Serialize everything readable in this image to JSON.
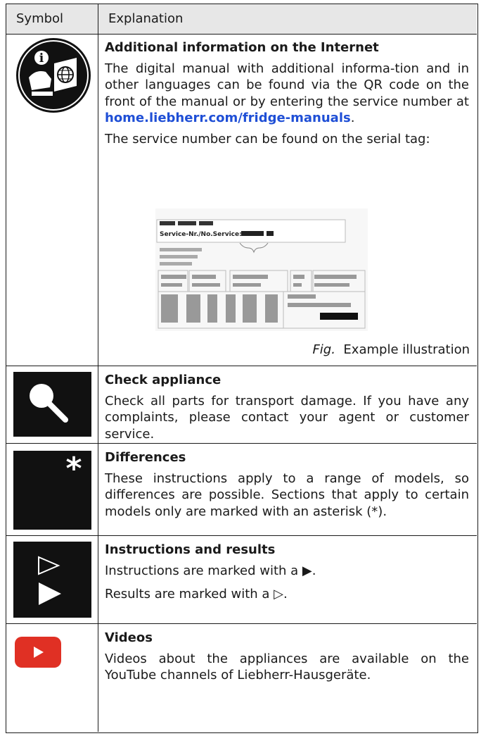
{
  "header": {
    "col1": "Symbol",
    "col2": "Explanation"
  },
  "rows": [
    {
      "title": "Additional information on the Internet",
      "p1a": "The digital manual with additional informa-tion and in other languages can be found via the QR code on the front of the manual or by entering the service number at ",
      "link": "home.liebherr.com/fridge-manuals",
      "p1b": ".",
      "p2": "The service number can be found on the serial tag:",
      "serial_tag_text": "Service-Nr./No.Service:",
      "caption_fig": "Fig.",
      "caption_text": "Example illustration"
    },
    {
      "title": "Check appliance",
      "text": "Check all parts for transport damage. If you have any complaints, please contact your agent or customer service."
    },
    {
      "title": "Differences",
      "text": "These instructions apply to a range of models, so differences are possible. Sections that apply to certain models only are marked with an asterisk (*)."
    },
    {
      "title": "Instructions and results",
      "line1": "Instructions are marked with a ▶.",
      "line2": "Results are marked with a ▷."
    },
    {
      "title": "Videos",
      "text": "Videos about the appliances are available on the YouTube channels of Liebherr-Hausgeräte."
    }
  ]
}
